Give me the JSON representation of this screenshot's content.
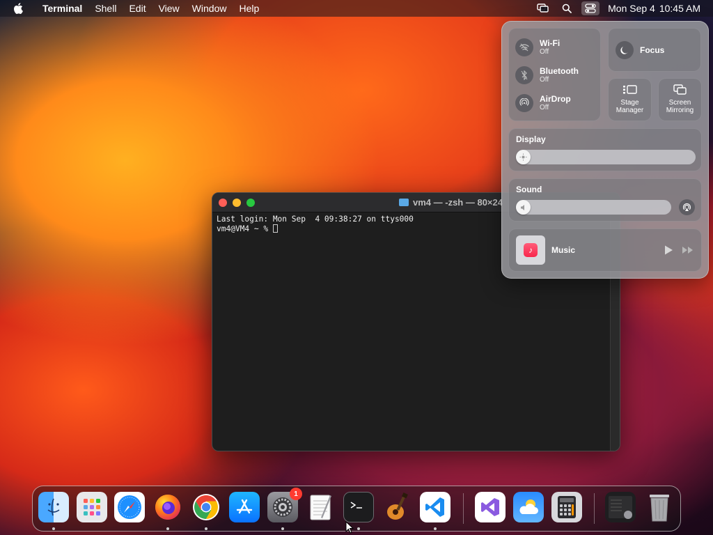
{
  "menubar": {
    "app_name": "Terminal",
    "menus": [
      "Shell",
      "Edit",
      "View",
      "Window",
      "Help"
    ],
    "clock_date": "Mon Sep 4",
    "clock_time": "10:45 AM"
  },
  "terminal": {
    "title": "vm4 — -zsh — 80×24",
    "lines": [
      "Last login: Mon Sep  4 09:38:27 on ttys000",
      "vm4@VM4 ~ % "
    ]
  },
  "control_center": {
    "wifi": {
      "label": "Wi-Fi",
      "status": "Off"
    },
    "bluetooth": {
      "label": "Bluetooth",
      "status": "Off"
    },
    "airdrop": {
      "label": "AirDrop",
      "status": "Off"
    },
    "focus": {
      "label": "Focus"
    },
    "stage_manager": {
      "label_line1": "Stage",
      "label_line2": "Manager"
    },
    "screen_mirroring": {
      "label_line1": "Screen",
      "label_line2": "Mirroring"
    },
    "display": {
      "title": "Display",
      "level": 0.0
    },
    "sound": {
      "title": "Sound",
      "level": 0.0
    },
    "music": {
      "label": "Music"
    }
  },
  "dock": {
    "apps": [
      {
        "name": "Finder",
        "running": true
      },
      {
        "name": "Launchpad",
        "running": false
      },
      {
        "name": "Safari",
        "running": false
      },
      {
        "name": "Firefox",
        "running": true
      },
      {
        "name": "Google Chrome",
        "running": true
      },
      {
        "name": "App Store",
        "running": false
      },
      {
        "name": "System Settings",
        "running": true,
        "badge": "1"
      },
      {
        "name": "TextEdit",
        "running": false
      },
      {
        "name": "Terminal",
        "running": true
      },
      {
        "name": "GarageBand",
        "running": false
      },
      {
        "name": "Visual Studio Code",
        "running": true
      },
      {
        "name": "Visual Studio",
        "running": false
      },
      {
        "name": "Weather",
        "running": false
      },
      {
        "name": "Calculator",
        "running": false
      },
      {
        "name": "Downloads",
        "running": false
      },
      {
        "name": "Trash",
        "running": false
      }
    ]
  },
  "colors": {
    "traffic_close": "#ff5f57",
    "traffic_min": "#febc2e",
    "traffic_max": "#28c840",
    "badge": "#ff3b30"
  }
}
